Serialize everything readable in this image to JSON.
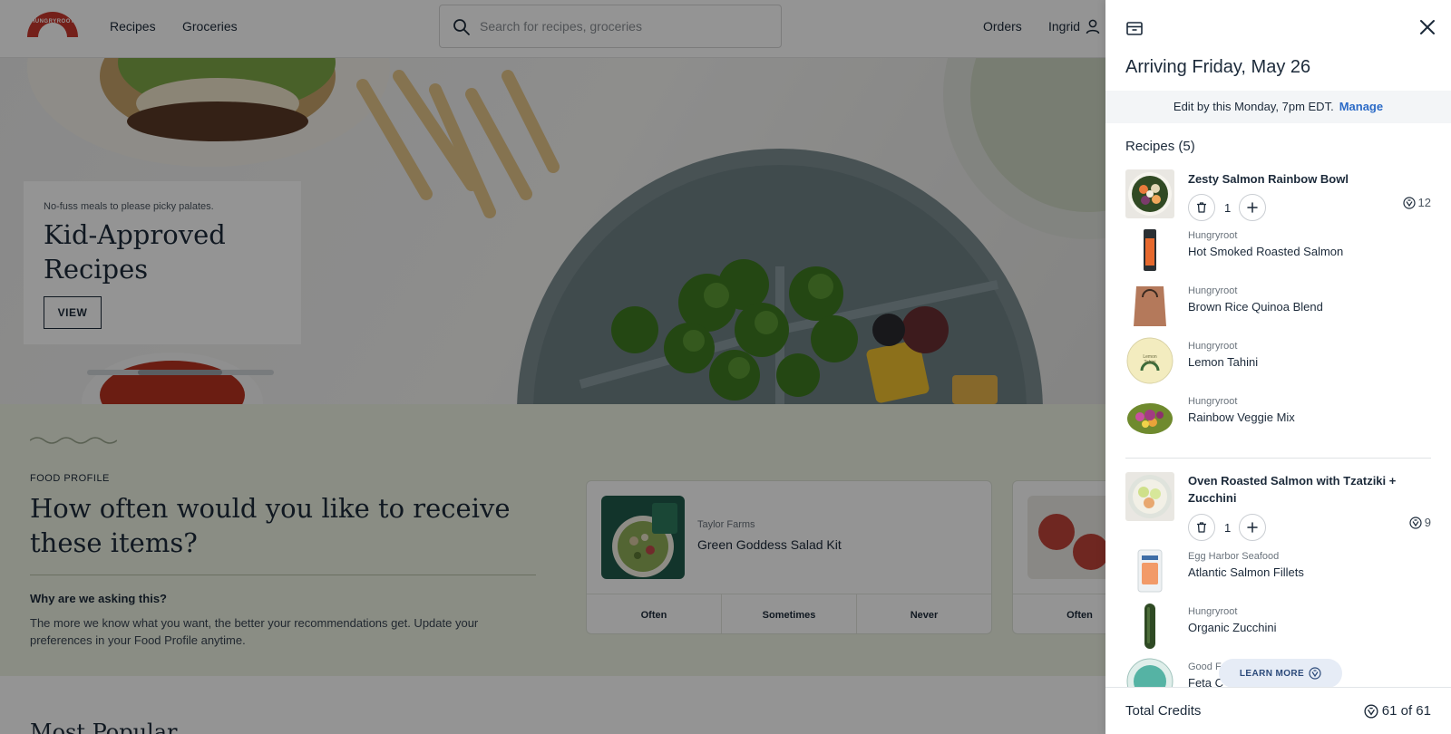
{
  "header": {
    "nav": [
      "Recipes",
      "Groceries"
    ],
    "search_placeholder": "Search for recipes, groceries",
    "orders_label": "Orders",
    "user_name": "Ingrid"
  },
  "hero": {
    "eyebrow": "No-fuss meals to please picky palates.",
    "title": "Kid-Approved Recipes",
    "button_label": "VIEW",
    "carousel_progress": 0.45
  },
  "food_profile": {
    "eyebrow": "FOOD PROFILE",
    "title": "How often would you like to receive these items?",
    "why_heading": "Why are we asking this?",
    "why_body": "The more we know what you want, the better your recommendations get. Update your preferences in your Food Profile anytime.",
    "cards": [
      {
        "brand": "Taylor Farms",
        "name": "Green Goddess Salad Kit",
        "options": [
          "Often",
          "Sometimes",
          "Never"
        ]
      },
      {
        "brand": "",
        "name": "",
        "options": [
          "Often"
        ]
      }
    ]
  },
  "section_title": "Most Popular",
  "drawer": {
    "arriving": "Arriving Friday, May 26",
    "edit_text": "Edit by this Monday, 7pm EDT.",
    "manage_label": "Manage",
    "recipes_heading": "Recipes (5)",
    "recipes": [
      {
        "title": "Zesty Salmon Rainbow Bowl",
        "qty": "1",
        "credits": "12",
        "ingredients": [
          {
            "brand": "Hungryroot",
            "name": "Hot Smoked Roasted Salmon"
          },
          {
            "brand": "Hungryroot",
            "name": "Brown Rice Quinoa Blend"
          },
          {
            "brand": "Hungryroot",
            "name": "Lemon Tahini"
          },
          {
            "brand": "Hungryroot",
            "name": "Rainbow Veggie Mix"
          }
        ]
      },
      {
        "title": "Oven Roasted Salmon with Tzatziki + Zucchini",
        "qty": "1",
        "credits": "9",
        "ingredients": [
          {
            "brand": "Egg Harbor Seafood",
            "name": "Atlantic Salmon Fillets"
          },
          {
            "brand": "Hungryroot",
            "name": "Organic Zucchini"
          },
          {
            "brand": "Good F",
            "name": "Feta C"
          }
        ]
      }
    ],
    "learn_more_label": "LEARN MORE",
    "total_credits_label": "Total Credits",
    "total_credits_value": "61 of 61"
  },
  "colors": {
    "navy_text": "#1c2a3a",
    "link_blue": "#2c6bc7",
    "profile_bg": "#eef3e4",
    "logo_red": "#c8372d",
    "overlay": "rgba(0,0,0,0.42)"
  }
}
